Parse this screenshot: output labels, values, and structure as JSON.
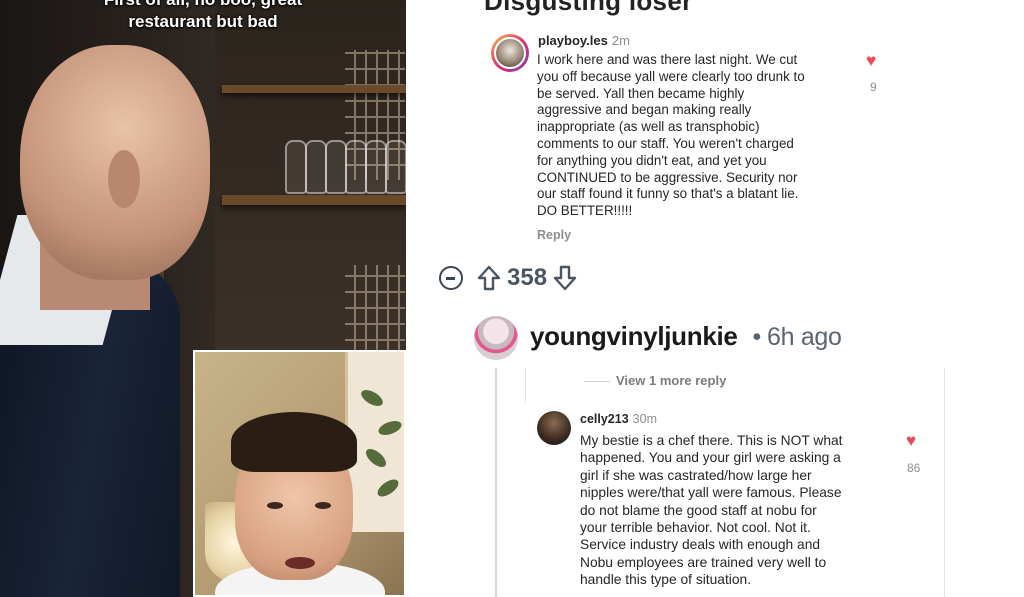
{
  "video": {
    "caption_line1": "First of all, no boo, great",
    "caption_line2": "restaurant but bad"
  },
  "comments_panel": {
    "top_heading": "Disgusting loser",
    "ig_comment_1": {
      "username": "playboy.les",
      "time": "2m",
      "text": "I work here and was there last night. We cut\nyou off because yall were clearly too drunk to\nbe served. Yall then became highly\naggressive and began making really\ninappropriate (as well as transphobic)\ncomments to our staff. You weren't charged\nfor anything you didn't eat, and yet you\nCONTINUED to be aggressive. Security nor\nour staff found it funny so that's a blatant lie.\nDO BETTER!!!!!",
      "reply_label": "Reply",
      "like_count": "9"
    },
    "vote": {
      "count": "358"
    },
    "reddit_comment": {
      "username": "youngvinyljunkie",
      "separator": "•",
      "time": "6h ago",
      "view_more": "View 1 more reply"
    },
    "ig_comment_2": {
      "username": "celly213",
      "time": "30m",
      "text": "My bestie is a chef there. This is NOT what\nhappened. You and your girl were asking a\ngirl if she was castrated/how large her\nnipples were/that yall were famous. Please\ndo not blame the good staff at nobu for\nyour terrible behavior. Not cool. Not it.\nService industry deals with enough and\nNobu employees are trained very well to\nhandle this type of situation.",
      "like_count": "86"
    }
  },
  "colors": {
    "heart": "#ed4956",
    "vote": "#4a5661",
    "muted": "#8e8e8e"
  }
}
